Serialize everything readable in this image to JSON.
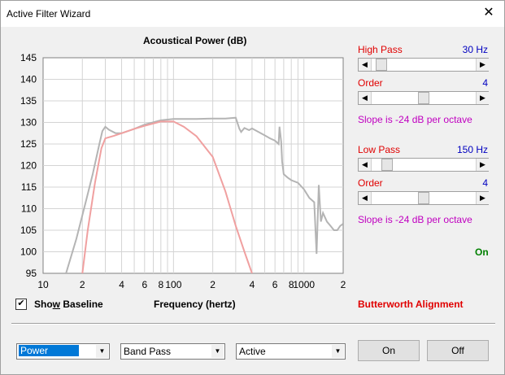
{
  "window": {
    "title": "Active Filter Wizard",
    "close_glyph": "✕"
  },
  "chart_data": {
    "type": "line",
    "title": "Acoustical Power (dB)",
    "xlabel": "Frequency (hertz)",
    "ylabel": "",
    "xscale": "log",
    "xlim": [
      10,
      2000
    ],
    "ylim": [
      95,
      145
    ],
    "grid": true,
    "x_tick_labels": [
      "10",
      "2",
      "4",
      "6",
      "8",
      "100",
      "2",
      "4",
      "6",
      "8",
      "1000",
      "2"
    ],
    "y_tick_labels": [
      "145",
      "140",
      "135",
      "130",
      "125",
      "120",
      "115",
      "110",
      "105",
      "100",
      "95"
    ],
    "series": [
      {
        "color": "#b4b4b4",
        "x": [
          15,
          18,
          21,
          24,
          27,
          28.5,
          30,
          32,
          36,
          40,
          50,
          60,
          80,
          100,
          150,
          200,
          250,
          300,
          320,
          330,
          350,
          380,
          400,
          500,
          550,
          600,
          640,
          650,
          670,
          680,
          700,
          750,
          800,
          900,
          1000,
          1100,
          1200,
          1250,
          1300,
          1350,
          1400,
          1500,
          1600,
          1700,
          1800,
          1900,
          2000
        ],
        "y": [
          95,
          103,
          111,
          118,
          125,
          128,
          129,
          128.3,
          127.5,
          127.5,
          128.5,
          129.5,
          130.5,
          130.8,
          130.8,
          130.9,
          130.9,
          131.1,
          128.5,
          127.8,
          128.7,
          128.2,
          128.6,
          127,
          126.3,
          125.8,
          125,
          129,
          125.5,
          121,
          118,
          117.2,
          116.6,
          116,
          114.5,
          112.5,
          111.5,
          99.5,
          115.5,
          107,
          109,
          107,
          106,
          105,
          105,
          106,
          106.5
        ]
      },
      {
        "color": "#f0a0a0",
        "x": [
          20,
          22,
          25,
          28,
          30,
          35,
          40,
          50,
          60,
          80,
          100,
          120,
          150,
          200,
          250,
          300,
          350,
          400
        ],
        "y": [
          95,
          105,
          116,
          124,
          126.3,
          126.9,
          127.5,
          128.5,
          129.2,
          130.2,
          130.2,
          129,
          126.8,
          122,
          114,
          106,
          100,
          95
        ]
      }
    ]
  },
  "controls": {
    "high_pass_label": "High Pass",
    "high_pass_value": "30 Hz",
    "high_pass_fraction": 0.05,
    "order1_label": "Order",
    "order1_value": "4",
    "order1_fraction": 0.5,
    "slope1_text": "Slope is -24 dB per octave",
    "low_pass_label": "Low Pass",
    "low_pass_value": "150 Hz",
    "low_pass_fraction": 0.11,
    "order2_label": "Order",
    "order2_value": "4",
    "order2_fraction": 0.5,
    "slope2_text": "Slope is -24 dB per octave",
    "status_text": "On",
    "alignment_text": "Butterworth Alignment"
  },
  "show_baseline": {
    "label_pre": "Sho",
    "label_accel": "w",
    "label_post": " Baseline",
    "checked": true,
    "check_glyph": "✔"
  },
  "bottom": {
    "mode_select": "Power",
    "type_select": "Band Pass",
    "kind_select": "Active",
    "on_button": "On",
    "off_button": "Off",
    "arrow_glyph": "▼"
  },
  "slider_arrows": {
    "left": "◀",
    "right": "▶"
  }
}
